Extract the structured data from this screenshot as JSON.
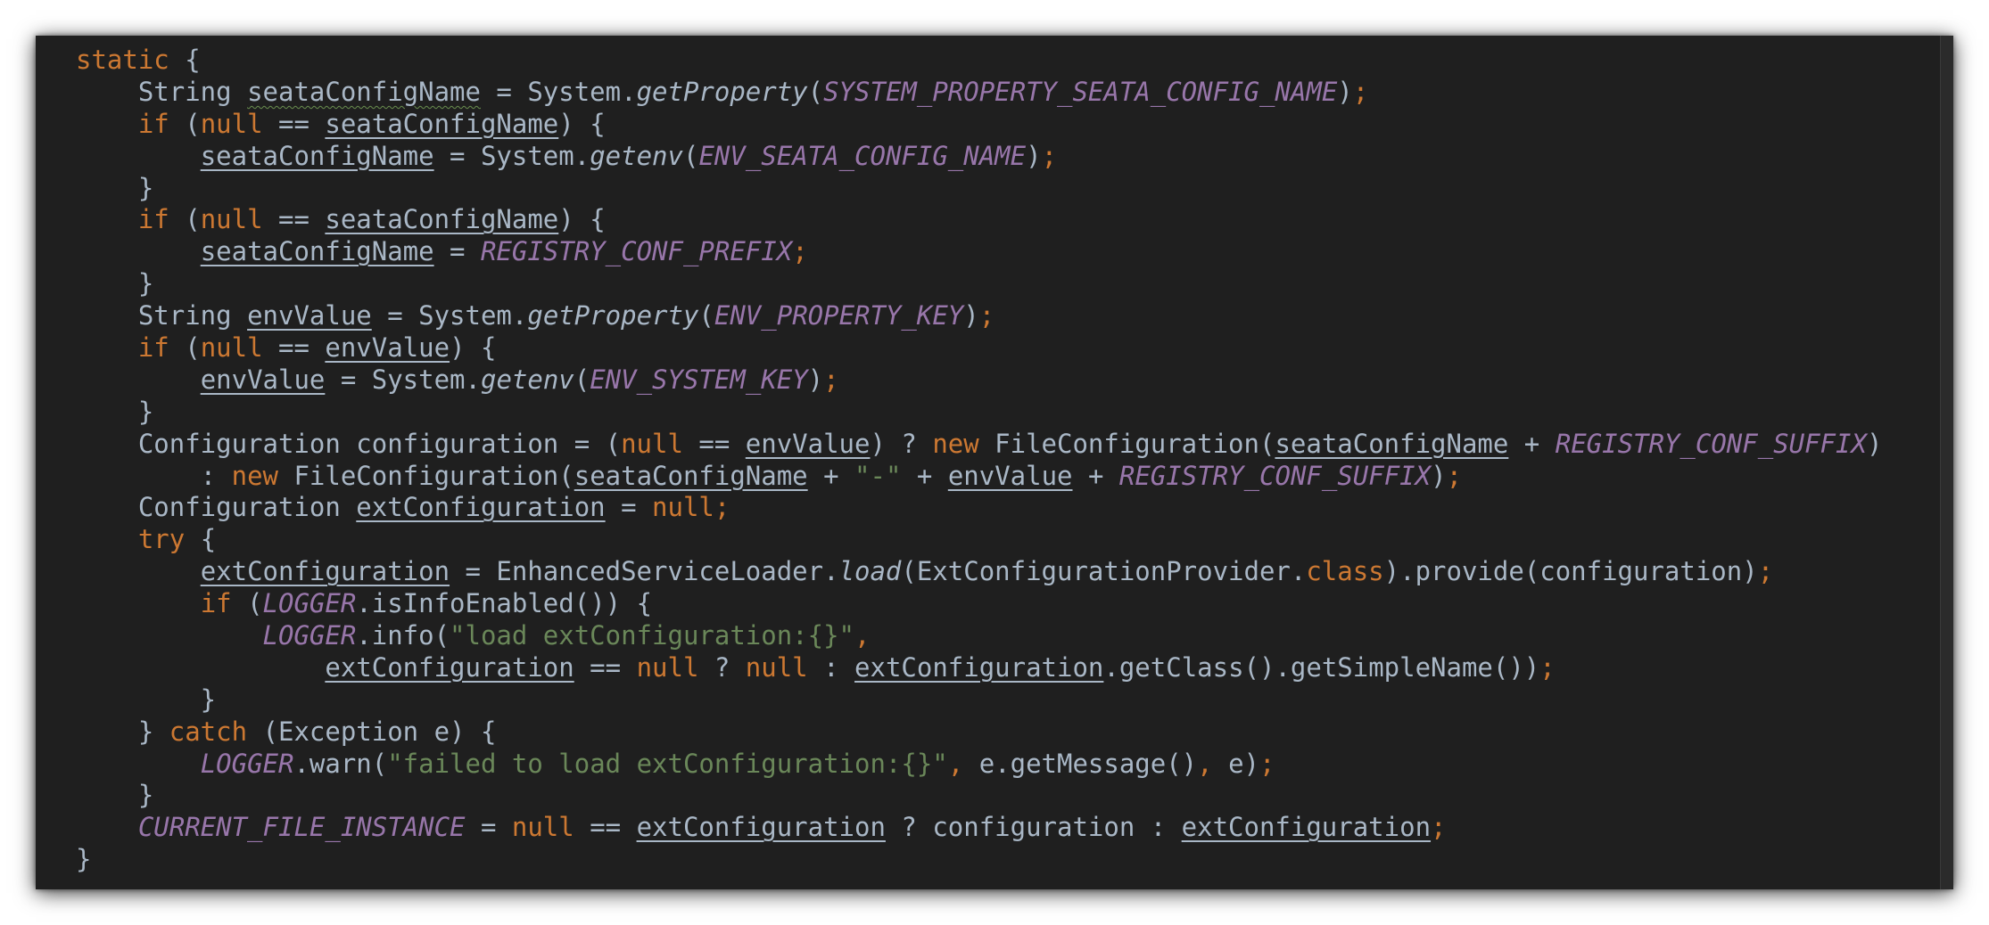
{
  "editor": {
    "language": "java",
    "theme": {
      "background": "#1f1f1f",
      "plain": "#a9b7c6",
      "keyword": "#cc7832",
      "constant": "#9876aa",
      "string": "#6a8759"
    },
    "lines": [
      [
        {
          "t": "kw",
          "v": "static"
        },
        {
          "t": "plain",
          "v": " {"
        }
      ],
      [
        {
          "t": "plain",
          "v": "    String "
        },
        {
          "t": "var-warn",
          "v": "seataConfigName"
        },
        {
          "t": "plain",
          "v": " = System."
        },
        {
          "t": "static-method",
          "v": "getProperty"
        },
        {
          "t": "plain",
          "v": "("
        },
        {
          "t": "const",
          "v": "SYSTEM_PROPERTY_SEATA_CONFIG_NAME"
        },
        {
          "t": "plain",
          "v": ")"
        },
        {
          "t": "punct",
          "v": ";"
        }
      ],
      [
        {
          "t": "plain",
          "v": "    "
        },
        {
          "t": "kw",
          "v": "if"
        },
        {
          "t": "plain",
          "v": " ("
        },
        {
          "t": "kw",
          "v": "null"
        },
        {
          "t": "plain",
          "v": " == "
        },
        {
          "t": "var",
          "v": "seataConfigName"
        },
        {
          "t": "plain",
          "v": ") {"
        }
      ],
      [
        {
          "t": "plain",
          "v": "        "
        },
        {
          "t": "var",
          "v": "seataConfigName"
        },
        {
          "t": "plain",
          "v": " = System."
        },
        {
          "t": "static-method",
          "v": "getenv"
        },
        {
          "t": "plain",
          "v": "("
        },
        {
          "t": "const",
          "v": "ENV_SEATA_CONFIG_NAME"
        },
        {
          "t": "plain",
          "v": ")"
        },
        {
          "t": "punct",
          "v": ";"
        }
      ],
      [
        {
          "t": "plain",
          "v": "    }"
        }
      ],
      [
        {
          "t": "plain",
          "v": "    "
        },
        {
          "t": "kw",
          "v": "if"
        },
        {
          "t": "plain",
          "v": " ("
        },
        {
          "t": "kw",
          "v": "null"
        },
        {
          "t": "plain",
          "v": " == "
        },
        {
          "t": "var",
          "v": "seataConfigName"
        },
        {
          "t": "plain",
          "v": ") {"
        }
      ],
      [
        {
          "t": "plain",
          "v": "        "
        },
        {
          "t": "var",
          "v": "seataConfigName"
        },
        {
          "t": "plain",
          "v": " = "
        },
        {
          "t": "const",
          "v": "REGISTRY_CONF_PREFIX"
        },
        {
          "t": "punct",
          "v": ";"
        }
      ],
      [
        {
          "t": "plain",
          "v": "    }"
        }
      ],
      [
        {
          "t": "plain",
          "v": "    String "
        },
        {
          "t": "var",
          "v": "envValue"
        },
        {
          "t": "plain",
          "v": " = System."
        },
        {
          "t": "static-method",
          "v": "getProperty"
        },
        {
          "t": "plain",
          "v": "("
        },
        {
          "t": "const",
          "v": "ENV_PROPERTY_KEY"
        },
        {
          "t": "plain",
          "v": ")"
        },
        {
          "t": "punct",
          "v": ";"
        }
      ],
      [
        {
          "t": "plain",
          "v": "    "
        },
        {
          "t": "kw",
          "v": "if"
        },
        {
          "t": "plain",
          "v": " ("
        },
        {
          "t": "kw",
          "v": "null"
        },
        {
          "t": "plain",
          "v": " == "
        },
        {
          "t": "var",
          "v": "envValue"
        },
        {
          "t": "plain",
          "v": ") {"
        }
      ],
      [
        {
          "t": "plain",
          "v": "        "
        },
        {
          "t": "var",
          "v": "envValue"
        },
        {
          "t": "plain",
          "v": " = System."
        },
        {
          "t": "static-method",
          "v": "getenv"
        },
        {
          "t": "plain",
          "v": "("
        },
        {
          "t": "const",
          "v": "ENV_SYSTEM_KEY"
        },
        {
          "t": "plain",
          "v": ")"
        },
        {
          "t": "punct",
          "v": ";"
        }
      ],
      [
        {
          "t": "plain",
          "v": "    }"
        }
      ],
      [
        {
          "t": "plain",
          "v": "    Configuration configuration = ("
        },
        {
          "t": "kw",
          "v": "null"
        },
        {
          "t": "plain",
          "v": " == "
        },
        {
          "t": "var",
          "v": "envValue"
        },
        {
          "t": "plain",
          "v": ") ? "
        },
        {
          "t": "kw",
          "v": "new"
        },
        {
          "t": "plain",
          "v": " FileConfiguration("
        },
        {
          "t": "var",
          "v": "seataConfigName"
        },
        {
          "t": "plain",
          "v": " + "
        },
        {
          "t": "const",
          "v": "REGISTRY_CONF_SUFFIX"
        },
        {
          "t": "plain",
          "v": ")"
        }
      ],
      [
        {
          "t": "plain",
          "v": "        : "
        },
        {
          "t": "kw",
          "v": "new"
        },
        {
          "t": "plain",
          "v": " FileConfiguration("
        },
        {
          "t": "var",
          "v": "seataConfigName"
        },
        {
          "t": "plain",
          "v": " + "
        },
        {
          "t": "str",
          "v": "\"-\""
        },
        {
          "t": "plain",
          "v": " + "
        },
        {
          "t": "var",
          "v": "envValue"
        },
        {
          "t": "plain",
          "v": " + "
        },
        {
          "t": "const",
          "v": "REGISTRY_CONF_SUFFIX"
        },
        {
          "t": "plain",
          "v": ")"
        },
        {
          "t": "punct",
          "v": ";"
        }
      ],
      [
        {
          "t": "plain",
          "v": "    Configuration "
        },
        {
          "t": "var",
          "v": "extConfiguration"
        },
        {
          "t": "plain",
          "v": " = "
        },
        {
          "t": "kw",
          "v": "null"
        },
        {
          "t": "punct",
          "v": ";"
        }
      ],
      [
        {
          "t": "plain",
          "v": "    "
        },
        {
          "t": "kw",
          "v": "try"
        },
        {
          "t": "plain",
          "v": " {"
        }
      ],
      [
        {
          "t": "plain",
          "v": "        "
        },
        {
          "t": "var",
          "v": "extConfiguration"
        },
        {
          "t": "plain",
          "v": " = EnhancedServiceLoader."
        },
        {
          "t": "static-method",
          "v": "load"
        },
        {
          "t": "plain",
          "v": "(ExtConfigurationProvider."
        },
        {
          "t": "kw",
          "v": "class"
        },
        {
          "t": "plain",
          "v": ").provide(configuration)"
        },
        {
          "t": "punct",
          "v": ";"
        }
      ],
      [
        {
          "t": "plain",
          "v": "        "
        },
        {
          "t": "kw",
          "v": "if"
        },
        {
          "t": "plain",
          "v": " ("
        },
        {
          "t": "const",
          "v": "LOGGER"
        },
        {
          "t": "plain",
          "v": ".isInfoEnabled()) {"
        }
      ],
      [
        {
          "t": "plain",
          "v": "            "
        },
        {
          "t": "const",
          "v": "LOGGER"
        },
        {
          "t": "plain",
          "v": ".info("
        },
        {
          "t": "str",
          "v": "\"load extConfiguration:{}\""
        },
        {
          "t": "punct",
          "v": ","
        }
      ],
      [
        {
          "t": "plain",
          "v": "                "
        },
        {
          "t": "var",
          "v": "extConfiguration"
        },
        {
          "t": "plain",
          "v": " == "
        },
        {
          "t": "kw",
          "v": "null"
        },
        {
          "t": "plain",
          "v": " ? "
        },
        {
          "t": "kw",
          "v": "null"
        },
        {
          "t": "plain",
          "v": " : "
        },
        {
          "t": "var",
          "v": "extConfiguration"
        },
        {
          "t": "plain",
          "v": ".getClass().getSimpleName())"
        },
        {
          "t": "punct",
          "v": ";"
        }
      ],
      [
        {
          "t": "plain",
          "v": "        }"
        }
      ],
      [
        {
          "t": "plain",
          "v": "    } "
        },
        {
          "t": "kw",
          "v": "catch"
        },
        {
          "t": "plain",
          "v": " (Exception e) {"
        }
      ],
      [
        {
          "t": "plain",
          "v": "        "
        },
        {
          "t": "const",
          "v": "LOGGER"
        },
        {
          "t": "plain",
          "v": ".warn("
        },
        {
          "t": "str",
          "v": "\"failed to load extConfiguration:{}\""
        },
        {
          "t": "punct",
          "v": ","
        },
        {
          "t": "plain",
          "v": " e.getMessage()"
        },
        {
          "t": "punct",
          "v": ","
        },
        {
          "t": "plain",
          "v": " e)"
        },
        {
          "t": "punct",
          "v": ";"
        }
      ],
      [
        {
          "t": "plain",
          "v": "    }"
        }
      ],
      [
        {
          "t": "plain",
          "v": "    "
        },
        {
          "t": "const",
          "v": "CURRENT_FILE_INSTANCE"
        },
        {
          "t": "plain",
          "v": " = "
        },
        {
          "t": "kw",
          "v": "null"
        },
        {
          "t": "plain",
          "v": " == "
        },
        {
          "t": "var",
          "v": "extConfiguration"
        },
        {
          "t": "plain",
          "v": " ? configuration : "
        },
        {
          "t": "var",
          "v": "extConfiguration"
        },
        {
          "t": "punct",
          "v": ";"
        }
      ],
      [
        {
          "t": "plain",
          "v": "}"
        }
      ]
    ]
  }
}
